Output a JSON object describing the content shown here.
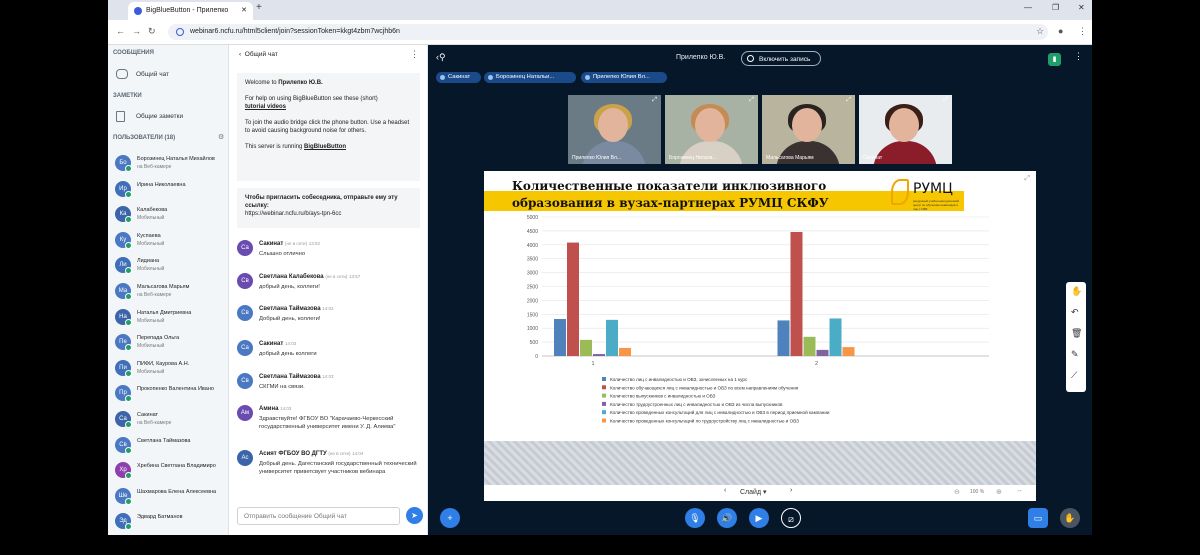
{
  "browser": {
    "tab_title": "BigBlueButton - Прилепко",
    "url": "webinar6.ncfu.ru/html5client/join?sessionToken=kkgt4zbm7wcjhb6n"
  },
  "sidebar": {
    "messages_title": "СООБЩЕНИЯ",
    "public_chat": "Общий чат",
    "notes_title": "ЗАМЕТКИ",
    "shared_notes": "Общие заметки",
    "users_title": "ПОЛЬЗОВАТЕЛИ (18)",
    "users": [
      {
        "initials": "Бо",
        "name": "Борозинец Наталья Михайлов",
        "sub": "на Веб-камере",
        "color": "#4a78c2"
      },
      {
        "initials": "Ир",
        "name": "Ирина Николаевна",
        "sub": "",
        "color": "#3f6fb8"
      },
      {
        "initials": "Ка",
        "name": "Калабекова",
        "sub": "Мобильный",
        "color": "#3b65a8"
      },
      {
        "initials": "Ку",
        "name": "Куспаева",
        "sub": "Мобильный",
        "color": "#4a78c2"
      },
      {
        "initials": "Ли",
        "name": "Лидиана",
        "sub": "Мобильный",
        "color": "#3f6fb8"
      },
      {
        "initials": "Ма",
        "name": "Мальсагова Марьям",
        "sub": "на Веб-камере",
        "color": "#4a78c2"
      },
      {
        "initials": "На",
        "name": "Наталья Дмитриевна",
        "sub": "Мобильный",
        "color": "#3b65a8"
      },
      {
        "initials": "Пе",
        "name": "Перепада Ольга",
        "sub": "Мобильный",
        "color": "#4a78c2"
      },
      {
        "initials": "Пи",
        "name": "ПИФИ, Каурова А.Н.",
        "sub": "Мобильный",
        "color": "#3f6fb8"
      },
      {
        "initials": "Пр",
        "name": "Прокопенко Валентина Ивано",
        "sub": "",
        "color": "#4a78c2"
      },
      {
        "initials": "Са",
        "name": "Сакинат",
        "sub": "на Веб-камере",
        "color": "#3b65a8"
      },
      {
        "initials": "Св",
        "name": "Светлана Таймазова",
        "sub": "",
        "color": "#4a78c2"
      },
      {
        "initials": "Хр",
        "name": "Хребина Светлана Владимиро",
        "sub": "",
        "color": "#8e3fae"
      },
      {
        "initials": "Ше",
        "name": "Шахмарова Елена Алексеевна",
        "sub": "",
        "color": "#4a78c2"
      },
      {
        "initials": "Эд",
        "name": "Эдвард Батманов",
        "sub": "",
        "color": "#3f6fb8"
      }
    ]
  },
  "chat": {
    "title": "Общий чат",
    "welcome_prefix": "Welcome to ",
    "welcome_name": "Прилепко Ю.В.",
    "help_text": "For help on using BigBlueButton see these (short)",
    "tutorial_link": "tutorial videos",
    "audio_text": "To join the audio bridge click the phone button. Use a headset to avoid causing background noise for others.",
    "server_prefix": "This server is running ",
    "server_link": "BigBlueButton",
    "invite_text": "Чтобы пригласить собеседника, отправьте ему эту ссылку:",
    "invite_link": "https://webinar.ncfu.ru/b/ays-tpn-6cc",
    "messages": [
      {
        "initials": "Са",
        "name": "Сакинат",
        "meta": "(не в сети)",
        "time": "13:52",
        "text": "Слышно отлично",
        "color": "#6a4bb0"
      },
      {
        "initials": "Св",
        "name": "Светлана Калабекова",
        "meta": "(не в сети)",
        "time": "13:57",
        "text": "добрый день, коллеги!",
        "color": "#6a4bb0"
      },
      {
        "initials": "Св",
        "name": "Светлана Таймазова",
        "meta": "",
        "time": "14:02",
        "text": "Добрый день, коллеги!",
        "color": "#4a78c2"
      },
      {
        "initials": "Са",
        "name": "Сакинат",
        "meta": "",
        "time": "14:03",
        "text": "добрый день коллеги",
        "color": "#4a78c2"
      },
      {
        "initials": "Св",
        "name": "Светлана Таймазова",
        "meta": "",
        "time": "14:03",
        "text": "СКГМИ на связи.",
        "color": "#4a78c2"
      },
      {
        "initials": "Ам",
        "name": "Амина",
        "meta": "",
        "time": "14:03",
        "text": "Здравствуйте! ФГБОУ ВО \"Карачаево-Черкесский государственный университет имени У. Д. Алиева\"",
        "color": "#6a4bb0"
      },
      {
        "initials": "Ас",
        "name": "Асият ФГБОУ ВО ДГТУ",
        "meta": "(не в сети)",
        "time": "14:04",
        "text": "Добрый день. Дагестанский государственный технический университет приветсвует участников вебинара",
        "color": "#3b65a8"
      }
    ],
    "input_placeholder": "Отправить сообщение Общий чат"
  },
  "main": {
    "presenter": "Прилепко Ю.В.",
    "record_label": "Включить запись",
    "talkers": [
      "Сакинат",
      "Борозинец Натальи...",
      "Прилепко Юлия Вл..."
    ],
    "videos": [
      {
        "label": "Прилепко Юлия Вл...",
        "hair": "#c9a24a",
        "body": "#7a8aa0",
        "bg": "#6b7b86"
      },
      {
        "label": "Борозинец Натали...",
        "hair": "#c58b55",
        "body": "#d8d0c4",
        "bg": "#a7b2a5"
      },
      {
        "label": "Мальсагова Марьям",
        "hair": "#2a2420",
        "body": "#3a3230",
        "bg": "#b8b49e"
      },
      {
        "label": "Сакинат",
        "hair": "#3a1f18",
        "body": "#8b1c2a",
        "bg": "#e9ecef"
      }
    ],
    "slide_label": "Слайд",
    "zoom": "100 %"
  },
  "slide": {
    "title": "Количественные показатели инклюзивного образования в вузах-партнерах РУМЦ СКФУ",
    "logo_text": "РУМЦ",
    "logo_sub": "ресурсный учебно-методический центр по обучению инвалидов и лиц с ОВЗ"
  },
  "chart_data": {
    "type": "bar",
    "categories": [
      "1",
      "2"
    ],
    "ylim": [
      0,
      5000
    ],
    "yticks": [
      0,
      500,
      1000,
      1500,
      2000,
      2500,
      3000,
      3500,
      4000,
      4500,
      5000
    ],
    "grid": true,
    "legend_position": "bottom",
    "series": [
      {
        "name": "Количество лиц с инвалидностью и ОВЗ, зачисленных на 1 курс",
        "color": "#4f81bd",
        "values": [
          1330,
          1280
        ]
      },
      {
        "name": "Количество обучающихся лиц с инвалидностью и ОВЗ по всем направлениям обучения",
        "color": "#c0504d",
        "values": [
          4080,
          4460
        ]
      },
      {
        "name": "Количество выпускников с инвалидностью и ОВЗ",
        "color": "#9bbb59",
        "values": [
          580,
          690
        ]
      },
      {
        "name": "Количество трудоустроенных лиц с инвалидностью и ОВЗ из числа выпускников",
        "color": "#8064a2",
        "values": [
          70,
          220
        ]
      },
      {
        "name": "Количество проведенных консультаций для лиц с инвалидностью и ОВЗ в период приемной кампании",
        "color": "#4bacc6",
        "values": [
          1300,
          1350
        ]
      },
      {
        "name": "Количество проведенных консультаций по трудоустройству лиц с инвалидностью и ОВЗ",
        "color": "#f79646",
        "values": [
          290,
          320
        ]
      }
    ]
  }
}
